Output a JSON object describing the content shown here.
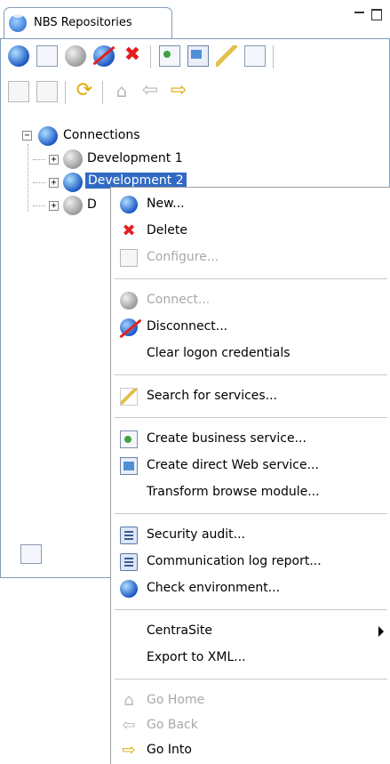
{
  "view": {
    "tab_title": "NBS Repositories",
    "icons": {
      "toolbar1": [
        "new-connection-icon",
        "configure-icon",
        "connect-icon",
        "disconnect-icon",
        "delete-icon",
        "create-business-service-icon",
        "create-web-service-icon",
        "search-services-icon",
        "transform-icon"
      ],
      "toolbar2": [
        "new-folder-icon",
        "properties-icon",
        "refresh-icon",
        "go-home-icon",
        "go-back-icon",
        "go-into-icon"
      ]
    }
  },
  "tree": {
    "root": "Connections",
    "children": [
      {
        "label": "Development 1",
        "state": "disconnected"
      },
      {
        "label": "Development 2",
        "state": "connected",
        "selected": true
      },
      {
        "label": "D",
        "state": "disconnected"
      }
    ]
  },
  "context_menu": {
    "items": [
      {
        "label": "New...",
        "icon": "new-icon",
        "enabled": true
      },
      {
        "label": "Delete",
        "icon": "delete-icon",
        "enabled": true
      },
      {
        "label": "Configure...",
        "icon": "configure-icon",
        "enabled": false
      },
      {
        "label": "Connect...",
        "icon": "connect-icon",
        "enabled": false
      },
      {
        "label": "Disconnect...",
        "icon": "disconnect-icon",
        "enabled": true
      },
      {
        "label": "Clear logon credentials",
        "icon": "",
        "enabled": true
      },
      {
        "label": "Search for services...",
        "icon": "search-services-icon",
        "enabled": true
      },
      {
        "label": "Create business service...",
        "icon": "create-business-service-icon",
        "enabled": true
      },
      {
        "label": "Create direct Web service...",
        "icon": "create-web-service-icon",
        "enabled": true
      },
      {
        "label": "Transform browse module...",
        "icon": "",
        "enabled": true
      },
      {
        "label": "Security audit...",
        "icon": "security-audit-icon",
        "enabled": true
      },
      {
        "label": "Communication log report...",
        "icon": "log-report-icon",
        "enabled": true
      },
      {
        "label": "Check environment...",
        "icon": "check-environment-icon",
        "enabled": true
      },
      {
        "label": "CentraSite",
        "icon": "",
        "enabled": true,
        "submenu": true
      },
      {
        "label": "Export to XML...",
        "icon": "",
        "enabled": true
      },
      {
        "label": "Go Home",
        "icon": "go-home-icon",
        "enabled": false
      },
      {
        "label": "Go Back",
        "icon": "go-back-icon",
        "enabled": false
      },
      {
        "label": "Go Into",
        "icon": "go-into-icon",
        "enabled": true
      }
    ]
  },
  "colors": {
    "selection": "#316ac5",
    "panel_border": "#7f9db9",
    "disabled_text": "#a8a8a8"
  }
}
